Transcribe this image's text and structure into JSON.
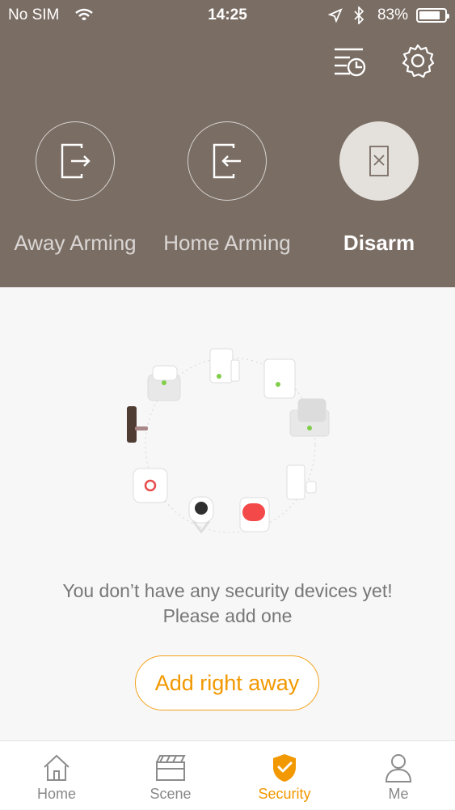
{
  "status_bar": {
    "carrier": "No SIM",
    "time": "14:25",
    "battery": "83%",
    "battery_level": 0.83
  },
  "header": {
    "actions": [
      {
        "icon": "history-list-icon"
      },
      {
        "icon": "gear-icon"
      }
    ],
    "modes": [
      {
        "label": "Away Arming",
        "icon": "exit-door-icon",
        "selected": false
      },
      {
        "label": "Home Arming",
        "icon": "enter-door-icon",
        "selected": false
      },
      {
        "label": "Disarm",
        "icon": "disarm-icon",
        "selected": true
      }
    ]
  },
  "empty_state": {
    "line1": "You don’t have any security devices yet!",
    "line2": "Please add one",
    "button": "Add right away",
    "illustration": "security-devices-circle-illustration"
  },
  "tabs": [
    {
      "label": "Home",
      "icon": "home-icon",
      "active": false
    },
    {
      "label": "Scene",
      "icon": "clapperboard-icon",
      "active": false
    },
    {
      "label": "Security",
      "icon": "shield-check-icon",
      "active": true
    },
    {
      "label": "Me",
      "icon": "user-icon",
      "active": false
    }
  ],
  "colors": {
    "header_bg": "#7a6d64",
    "accent": "#f29800",
    "page_bg": "#f7f7f7",
    "inactive_tab": "#888888"
  }
}
